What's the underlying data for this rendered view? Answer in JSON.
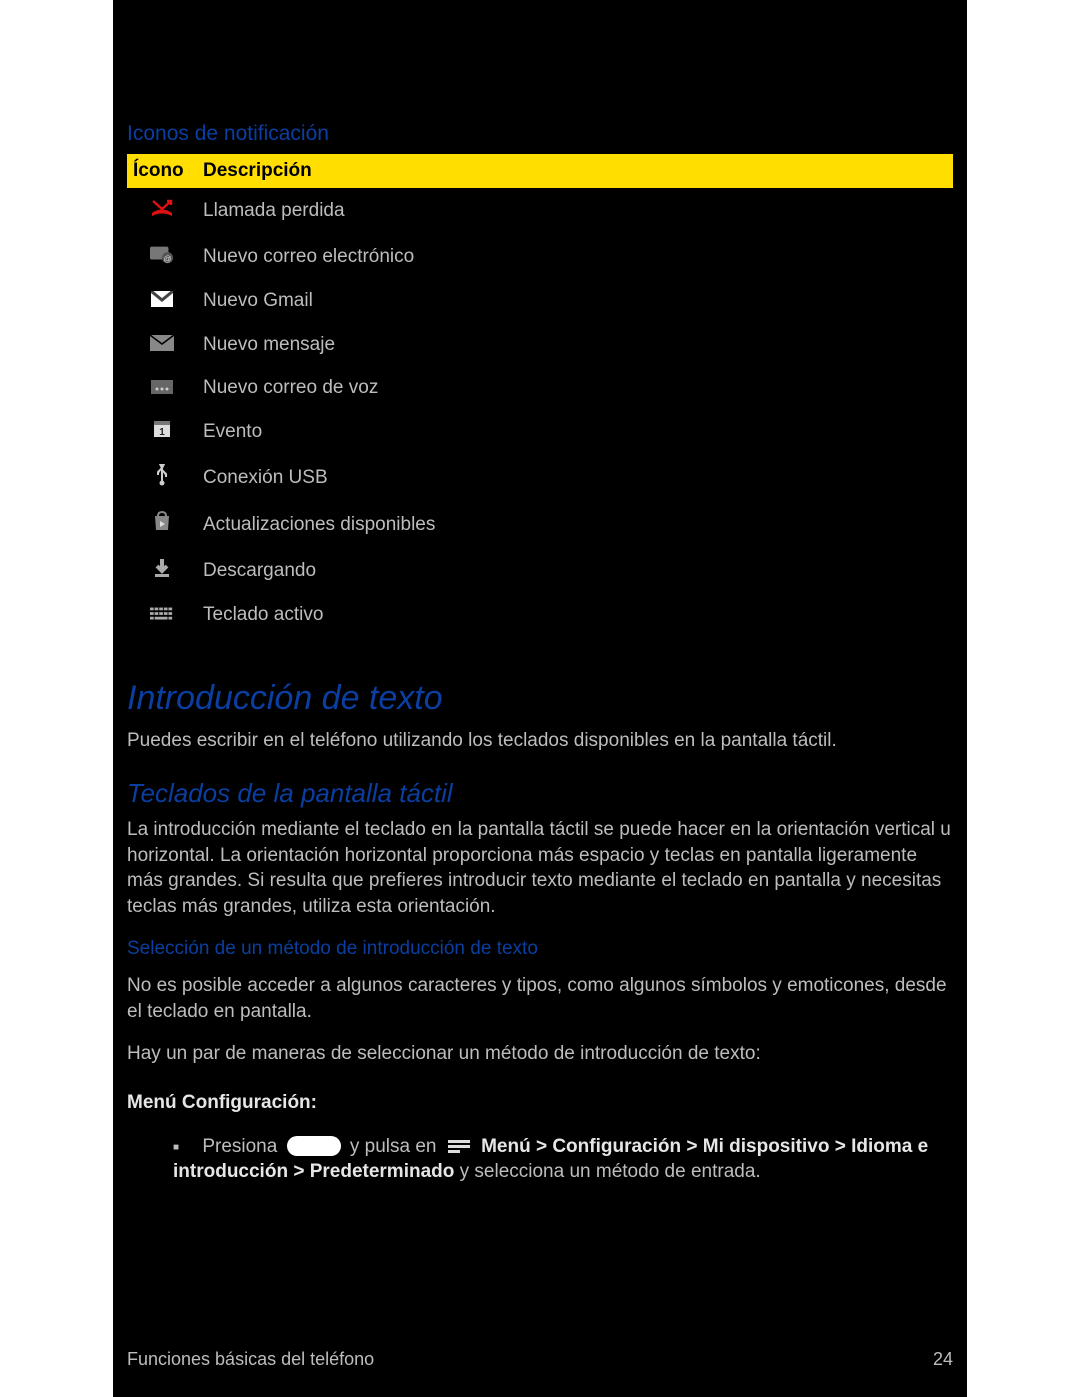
{
  "section_notification_icons_title": "Iconos de notificación",
  "table": {
    "header_icon": "Ícono",
    "header_desc": "Descripción",
    "rows": [
      {
        "key": "missed-call",
        "desc": "Llamada perdida"
      },
      {
        "key": "new-email",
        "desc": "Nuevo correo electrónico"
      },
      {
        "key": "new-gmail",
        "desc": "Nuevo Gmail"
      },
      {
        "key": "new-message",
        "desc": "Nuevo mensaje"
      },
      {
        "key": "new-voicemail",
        "desc": "Nuevo correo de voz"
      },
      {
        "key": "event",
        "desc": "Evento"
      },
      {
        "key": "usb",
        "desc": "Conexión USB"
      },
      {
        "key": "updates",
        "desc": "Actualizaciones disponibles"
      },
      {
        "key": "downloading",
        "desc": "Descargando"
      },
      {
        "key": "keyboard",
        "desc": "Teclado activo"
      }
    ]
  },
  "h1_text_entry": "Introducción de texto",
  "p_text_entry": "Puedes escribir en el teléfono utilizando los teclados disponibles en la pantalla táctil.",
  "h2_touch_keyboards": "Teclados de la pantalla táctil",
  "p_touch_keyboards": "La introducción mediante el teclado en la pantalla táctil se puede hacer en la orientación vertical u horizontal. La orientación horizontal proporciona más espacio y teclas en pantalla ligeramente más grandes. Si resulta que prefieres introducir texto mediante el teclado en pantalla y necesitas teclas más grandes, utiliza esta orientación.",
  "h4_select_method": "Selección de un método de introducción de texto",
  "p_not_possible": "No es posible acceder a algunos caracteres y tipos, como algunos símbolos y emoticones, desde el teclado en pantalla.",
  "p_couple_ways": "Hay un par de maneras de seleccionar un método de introducción de texto:",
  "label_menu_config": "Menú Configuración:",
  "bullet": {
    "press": "Presiona",
    "and_tap": "y pulsa en",
    "path": "Menú > Configuración > Mi dispositivo > Idioma e introducción > Predeterminado",
    "tail": " y selecciona un método de entrada."
  },
  "footer_left": "Funciones básicas del teléfono",
  "footer_right": "24"
}
